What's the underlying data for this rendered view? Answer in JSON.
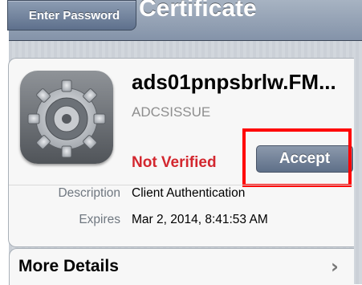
{
  "navbar": {
    "back_label": "Enter Password",
    "title": "Certificate"
  },
  "certificate": {
    "name": "ads01pnpsbrlw.FM...",
    "issuer": "ADCSISSUE",
    "status": "Not Verified",
    "accept_label": "Accept",
    "icon": "settings-gear-icon"
  },
  "details": [
    {
      "label": "Description",
      "value": "Client Authentication"
    },
    {
      "label": "Expires",
      "value": "Mar 2, 2014, 8:41:53 AM"
    }
  ],
  "more_details": {
    "label": "More Details",
    "icon": "chevron-right-icon"
  },
  "colors": {
    "status_red": "#d3272f",
    "highlight_red": "#ff0000",
    "navbar_blue": "#8493a9"
  }
}
